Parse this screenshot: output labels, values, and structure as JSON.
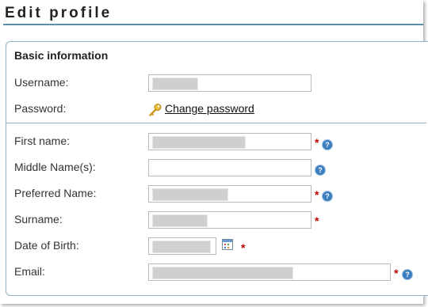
{
  "page": {
    "title": "Edit profile"
  },
  "section": {
    "title": "Basic information"
  },
  "fields": {
    "username_label": "Username:",
    "password_label": "Password:",
    "change_password": "Change password",
    "first_name_label": "First name:",
    "middle_name_label": "Middle Name(s):",
    "preferred_name_label": "Preferred Name:",
    "surname_label": "Surname:",
    "dob_label": "Date of Birth:",
    "email_label": "Email:"
  },
  "required_marker": "*",
  "help_glyph": "?",
  "icons": {
    "password": "key-icon",
    "date_picker": "calendar-icon",
    "help": "help-icon"
  },
  "colors": {
    "accent": "#5b8fa8",
    "required": "#c00000",
    "help": "#3d7ebf"
  }
}
